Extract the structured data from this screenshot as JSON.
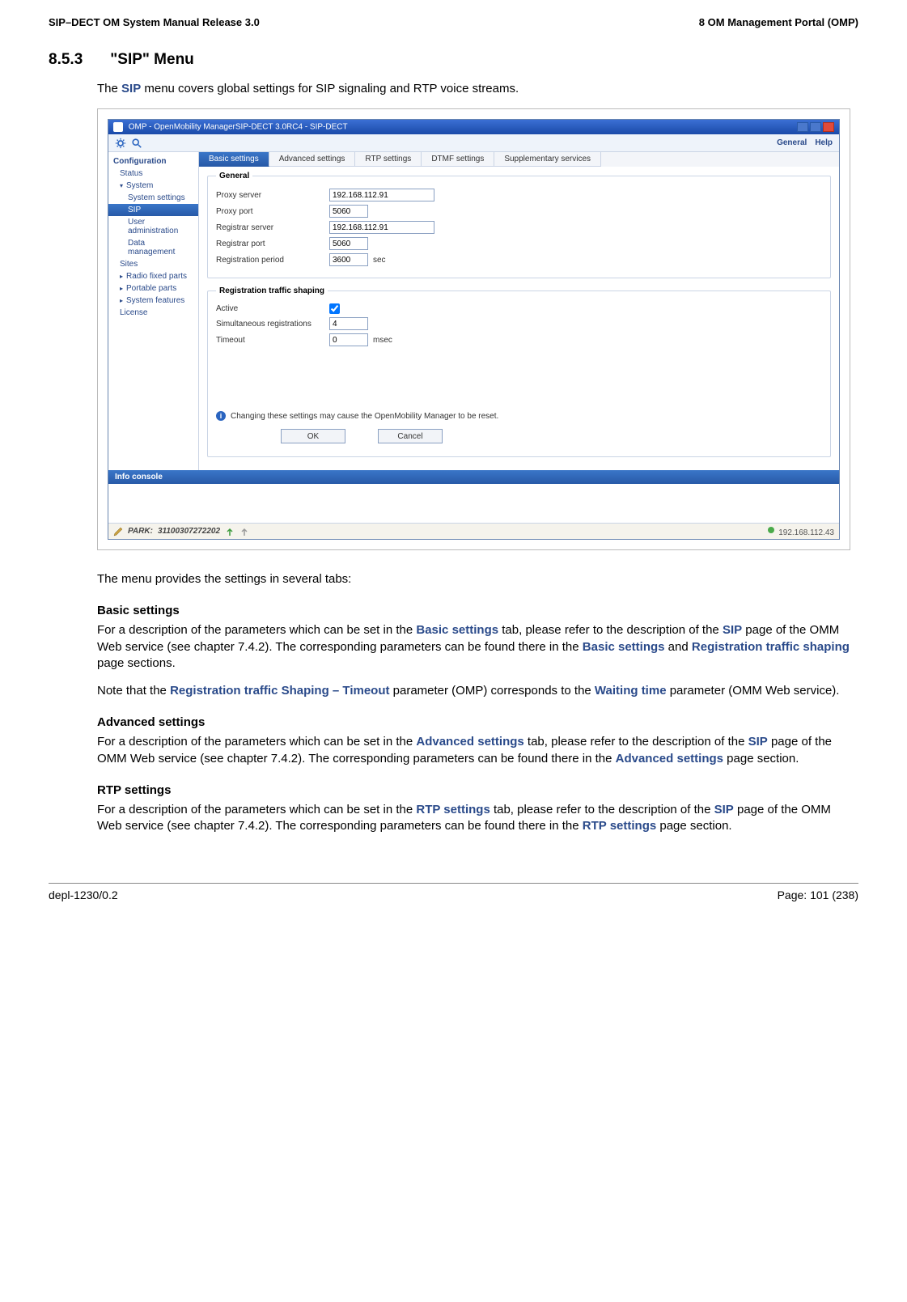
{
  "header": {
    "left": "SIP–DECT OM System Manual Release 3.0",
    "right": "8 OM Management Portal (OMP)"
  },
  "heading": {
    "number": "8.5.3",
    "title": "\"SIP\" Menu"
  },
  "intro": {
    "before_sip": "The ",
    "sip": "SIP",
    "after_sip": " menu covers global settings for SIP signaling and RTP voice streams."
  },
  "app": {
    "title": "OMP - OpenMobility ManagerSIP-DECT 3.0RC4 - SIP-DECT",
    "top_links": {
      "general": "General",
      "help": "Help"
    },
    "sidebar": {
      "header": "Configuration",
      "status": "Status",
      "system": "System",
      "system_settings": "System settings",
      "sip": "SIP",
      "user_admin": "User administration",
      "data_mgmt": "Data management",
      "sites": "Sites",
      "radio_fixed": "Radio fixed parts",
      "portable": "Portable parts",
      "sys_features": "System features",
      "license": "License"
    },
    "tabs": {
      "basic": "Basic settings",
      "advanced": "Advanced settings",
      "rtp": "RTP settings",
      "dtmf": "DTMF settings",
      "supp": "Supplementary services"
    },
    "general_fieldset": {
      "legend": "General",
      "proxy_server_label": "Proxy server",
      "proxy_server_value": "192.168.112.91",
      "proxy_port_label": "Proxy port",
      "proxy_port_value": "5060",
      "registrar_server_label": "Registrar server",
      "registrar_server_value": "192.168.112.91",
      "registrar_port_label": "Registrar port",
      "registrar_port_value": "5060",
      "reg_period_label": "Registration period",
      "reg_period_value": "3600",
      "reg_period_unit": "sec"
    },
    "rts_fieldset": {
      "legend": "Registration traffic shaping",
      "active_label": "Active",
      "simul_label": "Simultaneous registrations",
      "simul_value": "4",
      "timeout_label": "Timeout",
      "timeout_value": "0",
      "timeout_unit": "msec"
    },
    "note": "Changing these settings may cause the OpenMobility Manager to be reset.",
    "buttons": {
      "ok": "OK",
      "cancel": "Cancel"
    },
    "info_console": "Info console",
    "status": {
      "park_label": "PARK:",
      "park_value": "31100307272202",
      "ip": "192.168.112.43"
    }
  },
  "doc": {
    "menu_tabs_text": "The menu provides the settings in several tabs:",
    "basic_head": "Basic settings",
    "basic_p1_a": "For a description of the parameters which can be set in the ",
    "basic_p1_b": "Basic settings",
    "basic_p1_c": " tab, please refer to the description of the ",
    "basic_p1_d": "SIP",
    "basic_p1_e": " page of the OMM Web service (see chapter 7.4.2). The corresponding parameters can be found there in the ",
    "basic_p1_f": "Basic settings",
    "basic_p1_g": " and ",
    "basic_p1_h": "Registration traffic shaping",
    "basic_p1_i": " page sections.",
    "basic_p2_a": "Note that the ",
    "basic_p2_b": "Registration traffic Shaping – Timeout",
    "basic_p2_c": " parameter (OMP) corresponds to the ",
    "basic_p2_d": "Waiting time",
    "basic_p2_e": " parameter (OMM Web service).",
    "adv_head": "Advanced settings",
    "adv_p1_a": "For a description of the parameters which can be set in the ",
    "adv_p1_b": "Advanced settings",
    "adv_p1_c": " tab, please refer to the description of the ",
    "adv_p1_d": "SIP",
    "adv_p1_e": " page of the OMM Web service (see chapter 7.4.2). The corresponding parameters can be found there in the ",
    "adv_p1_f": "Advanced settings",
    "adv_p1_g": " page section.",
    "rtp_head": "RTP settings",
    "rtp_p1_a": "For a description of the parameters which can be set in the ",
    "rtp_p1_b": "RTP settings",
    "rtp_p1_c": " tab, please refer to the description of the ",
    "rtp_p1_d": "SIP",
    "rtp_p1_e": " page of the OMM Web service (see chapter 7.4.2). The corresponding parameters can be found there in the ",
    "rtp_p1_f": "RTP settings",
    "rtp_p1_g": " page section."
  },
  "footer": {
    "left": "depl-1230/0.2",
    "right": "Page: 101 (238)"
  }
}
